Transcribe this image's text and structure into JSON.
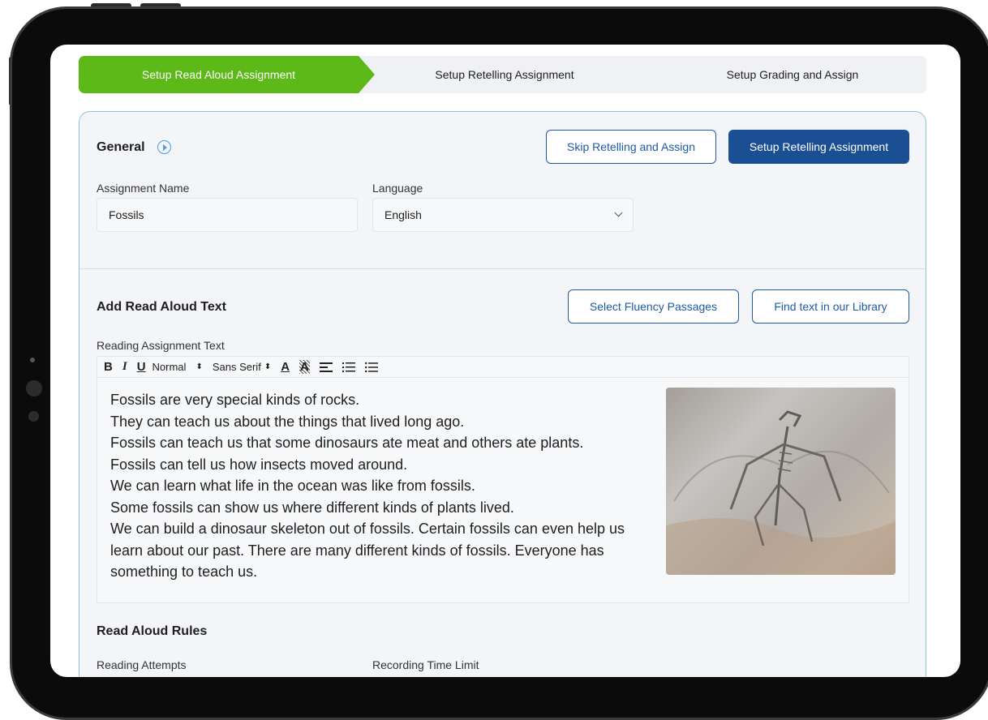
{
  "stepper": {
    "step1": "Setup Read Aloud Assignment",
    "step2": "Setup Retelling Assignment",
    "step3": "Setup Grading and Assign"
  },
  "general": {
    "title": "General",
    "skip_button": "Skip Retelling and Assign",
    "setup_button": "Setup Retelling Assignment",
    "assignment_name_label": "Assignment Name",
    "assignment_name_value": "Fossils",
    "language_label": "Language",
    "language_value": "English"
  },
  "read_aloud": {
    "title": "Add Read Aloud Text",
    "fluency_button": "Select Fluency Passages",
    "library_button": "Find text in our Library",
    "text_label": "Reading Assignment Text",
    "toolbar": {
      "bold": "B",
      "italic": "I",
      "underline": "U",
      "size": "Normal",
      "font": "Sans Serif",
      "color": "A",
      "background": "A"
    },
    "lines": [
      "Fossils are very special kinds of rocks.",
      "They can teach us about the things that lived long ago.",
      "Fossils can teach us that some dinosaurs ate meat and others ate plants.",
      "Fossils can tell us how insects moved around.",
      "We can learn what life in the ocean was like from fossils.",
      "Some fossils can show us where different kinds of plants lived.",
      "We can build a dinosaur skeleton out of fossils. Certain fossils can even help us learn about our past. There are many different kinds of fossils. Everyone has something to teach us."
    ]
  },
  "rules": {
    "title": "Read Aloud Rules",
    "attempts_label": "Reading Attempts",
    "time_limit_label": "Recording Time Limit"
  }
}
